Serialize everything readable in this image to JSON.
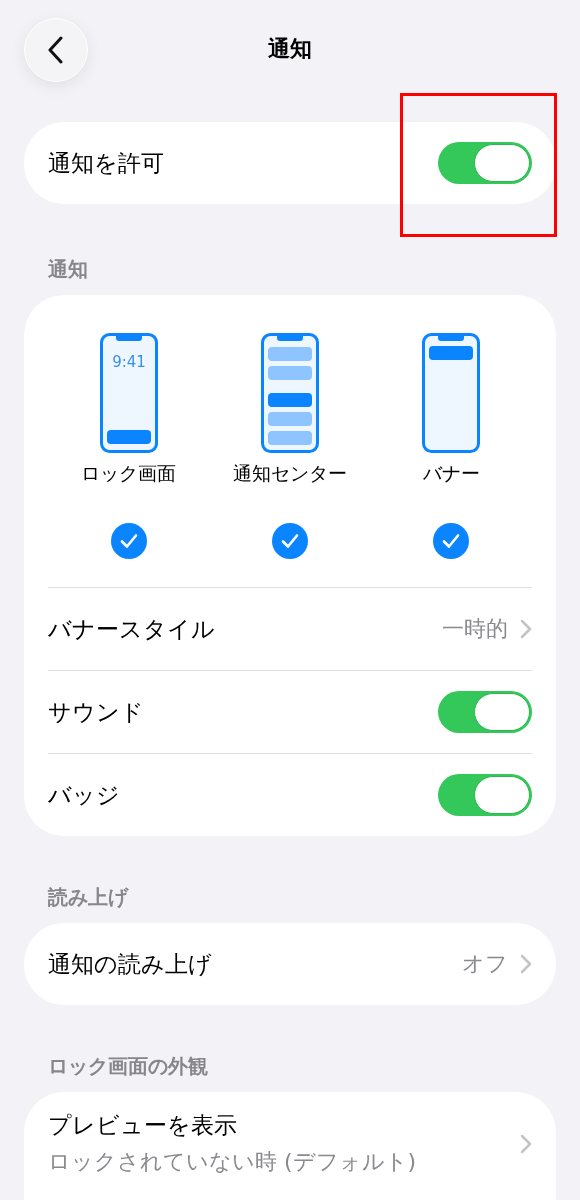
{
  "nav": {
    "title": "通知"
  },
  "allow": {
    "label": "通知を許可",
    "on": true
  },
  "notifications": {
    "header": "通知",
    "styles": [
      {
        "kind": "lock",
        "label": "ロック画面",
        "clock": "9:41",
        "checked": true
      },
      {
        "kind": "center",
        "label": "通知センター",
        "checked": true
      },
      {
        "kind": "banner",
        "label": "バナー",
        "checked": true
      }
    ],
    "rows": [
      {
        "kind": "value",
        "label": "バナースタイル",
        "value": "一時的"
      },
      {
        "kind": "toggle",
        "label": "サウンド",
        "on": true
      },
      {
        "kind": "toggle",
        "label": "バッジ",
        "on": true
      }
    ]
  },
  "announce": {
    "header": "読み上げ",
    "rows": [
      {
        "kind": "value",
        "label": "通知の読み上げ",
        "value": "オフ"
      }
    ]
  },
  "lock_appearance": {
    "header": "ロック画面の外観",
    "rows": [
      {
        "kind": "subtitle",
        "label": "プレビューを表示",
        "subtitle": "ロックされていない時 (デフォルト)"
      }
    ]
  }
}
